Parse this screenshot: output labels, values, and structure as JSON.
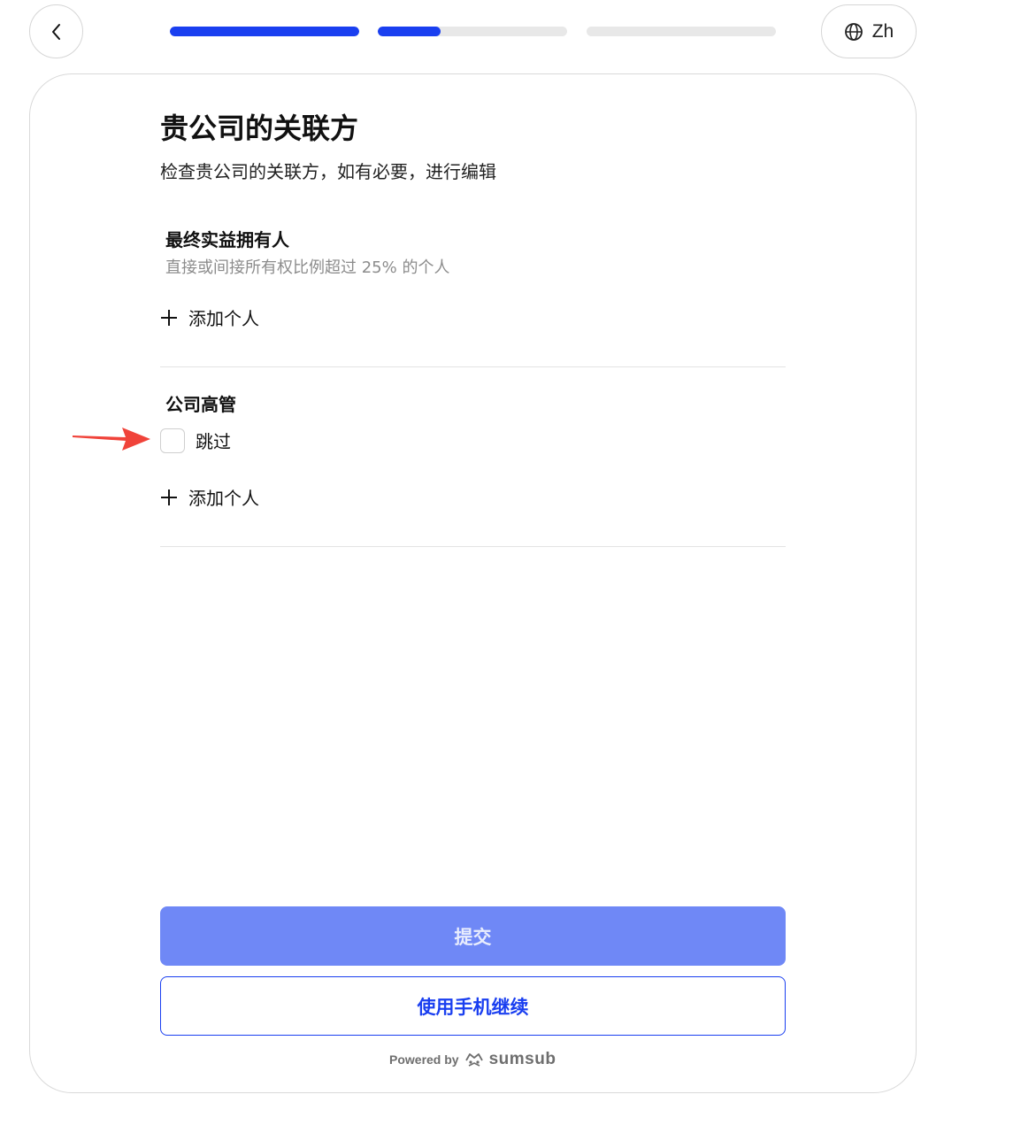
{
  "header": {
    "back_icon": "chevron-left-icon",
    "progress": [
      {
        "fill": 1.0
      },
      {
        "fill": 0.33
      },
      {
        "fill": 0.0
      }
    ],
    "language": {
      "icon": "globe-icon",
      "label": "Zh"
    }
  },
  "page": {
    "title": "贵公司的关联方",
    "subtitle": "检查贵公司的关联方，如有必要，进行编辑"
  },
  "beneficial_owners": {
    "title": "最终实益拥有人",
    "description": "直接或间接所有权比例超过 25% 的个人",
    "add_label": "添加个人"
  },
  "executives": {
    "title": "公司高管",
    "skip_label": "跳过",
    "skip_checked": false,
    "add_label": "添加个人"
  },
  "actions": {
    "submit_label": "提交",
    "mobile_label": "使用手机继续"
  },
  "footer": {
    "powered_by": "Powered by",
    "brand": "sumsub"
  },
  "colors": {
    "accent": "#1a3ff0",
    "submit_disabled": "#6f88f6",
    "annotation_arrow": "#f0433a"
  }
}
